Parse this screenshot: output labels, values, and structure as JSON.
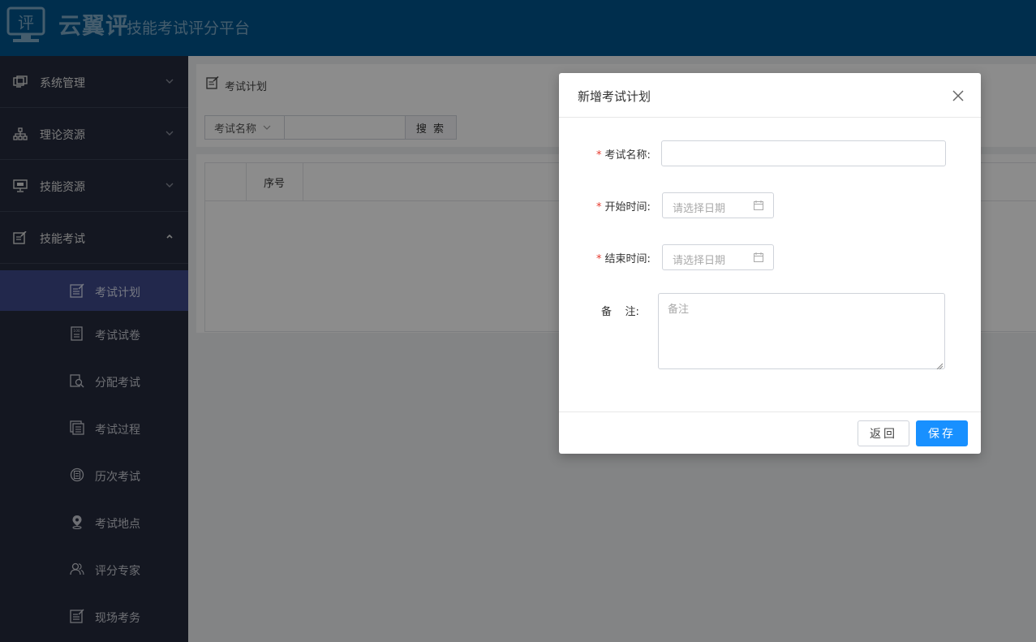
{
  "header": {
    "logo_char": "评",
    "app_name": "云翼评",
    "subtitle": "技能考试评分平台"
  },
  "sidebar": {
    "groups": [
      {
        "label": "系统管理",
        "icon": "monitor-icon",
        "expanded": false
      },
      {
        "label": "理论资源",
        "icon": "sitemap-icon",
        "expanded": false
      },
      {
        "label": "技能资源",
        "icon": "screen-icon",
        "expanded": false
      },
      {
        "label": "技能考试",
        "icon": "edit-icon",
        "expanded": true
      }
    ],
    "items": [
      {
        "label": "考试计划",
        "icon": "plan-icon",
        "active": true
      },
      {
        "label": "考试试卷",
        "icon": "paper-icon",
        "active": false
      },
      {
        "label": "分配考试",
        "icon": "assign-icon",
        "active": false
      },
      {
        "label": "考试过程",
        "icon": "process-icon",
        "active": false
      },
      {
        "label": "历次考试",
        "icon": "history-icon",
        "active": false
      },
      {
        "label": "考试地点",
        "icon": "location-icon",
        "active": false
      },
      {
        "label": "评分专家",
        "icon": "experts-icon",
        "active": false
      },
      {
        "label": "现场考务",
        "icon": "onsite-icon",
        "active": false
      }
    ]
  },
  "main": {
    "breadcrumb": "考试计划",
    "search": {
      "field_select": "考试名称",
      "input_value": "",
      "button_label": "搜 索"
    },
    "table": {
      "columns": [
        "",
        "序号"
      ]
    }
  },
  "modal": {
    "title": "新增考试计划",
    "fields": {
      "name": {
        "label": "考试名称:",
        "required": true,
        "value": ""
      },
      "start": {
        "label": "开始时间:",
        "required": true,
        "placeholder": "请选择日期"
      },
      "end": {
        "label": "结束时间:",
        "required": true,
        "placeholder": "请选择日期"
      },
      "remark": {
        "label": "备    注:",
        "required": false,
        "placeholder": "备注"
      }
    },
    "buttons": {
      "back": "返回",
      "save": "保存"
    }
  },
  "colors": {
    "header_bg": "#00548c",
    "sidebar_bg": "#252b3d",
    "sidebar_active": "#3e4a8b",
    "primary": "#1890ff",
    "required": "#e63a2e"
  }
}
